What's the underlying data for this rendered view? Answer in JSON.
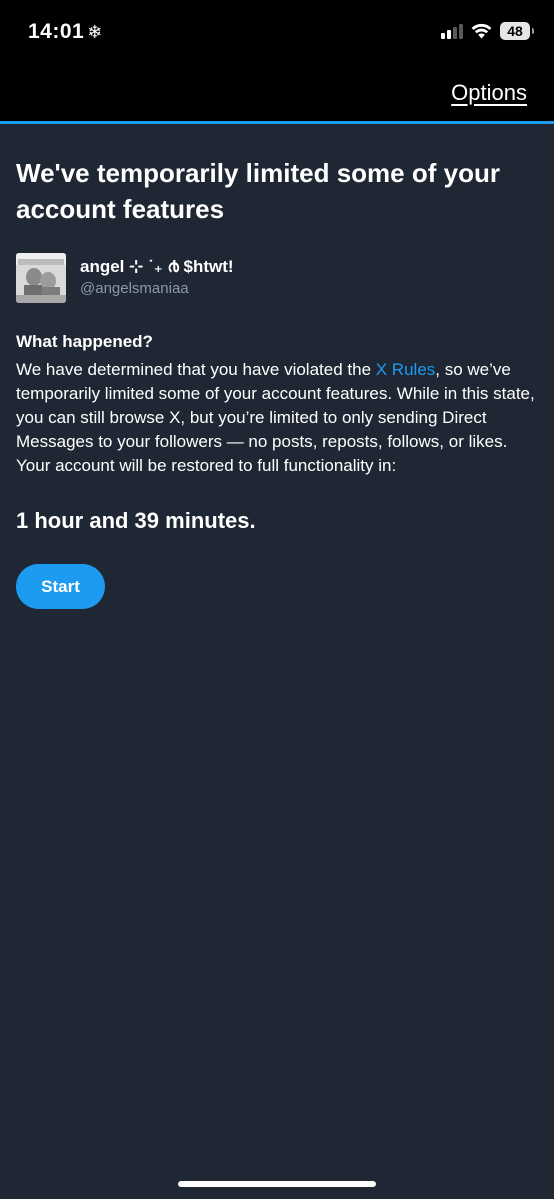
{
  "status_bar": {
    "time": "14:01",
    "focus_icon": "snowflake-icon",
    "battery": "48"
  },
  "nav": {
    "options_label": "Options"
  },
  "colors": {
    "accent": "#1d9bf0",
    "background": "#1e2733",
    "topbar": "#000000",
    "muted_text": "#8b98a5"
  },
  "page": {
    "headline": "We've temporarily limited some of your account features",
    "account": {
      "display_name": "angel ⊹ ˙₊ ൪ $htwt!",
      "handle": "@angelsmaniaa"
    },
    "section_title": "What happened?",
    "body_before_link": "We have determined that you have violated the ",
    "rules_link": "X Rules",
    "body_after_link": ", so we’ve temporarily limited some of your account features. While in this state, you can still browse X, but you’re limited to only sending Direct Messages to your followers — no posts, reposts, follows, or likes. Your account will be restored to full functionality in:",
    "countdown": "1 hour and 39 minutes.",
    "start_label": "Start"
  }
}
